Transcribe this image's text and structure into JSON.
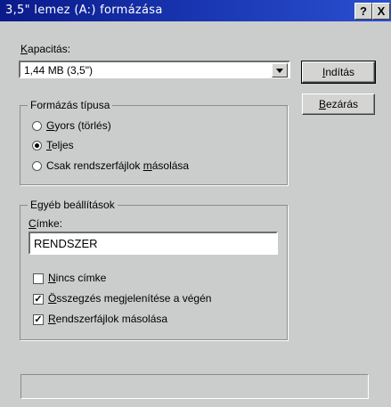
{
  "window": {
    "title": "3,5\" lemez (A:) formázása",
    "help_glyph": "?",
    "close_glyph": "X"
  },
  "capacity": {
    "label": "Kapacitás:",
    "label_key": "K",
    "label_rest": "apacitás:",
    "value": "1,44 MB (3,5\")"
  },
  "buttons": {
    "start": "Indítás",
    "start_key": "I",
    "start_rest": "ndítás",
    "close": "Bezárás",
    "close_key": "B",
    "close_rest": "ezárás"
  },
  "format_type": {
    "title": "Formázás típusa",
    "options": [
      {
        "pre": "",
        "key": "G",
        "rest": "yors (törlés)",
        "selected": false
      },
      {
        "pre": "",
        "key": "T",
        "rest": "eljes",
        "selected": true
      },
      {
        "pre": "Csak rendszerfájlok ",
        "key": "m",
        "rest": "ásolása",
        "selected": false
      }
    ]
  },
  "other": {
    "title": "Egyéb beállítások",
    "label_key": "C",
    "label_rest": "ímke:",
    "label_value": "RENDSZER",
    "checks": [
      {
        "key": "N",
        "rest": "incs címke",
        "checked": false
      },
      {
        "key": "Ö",
        "rest": "sszegzés megjelenítése a végén",
        "checked": true
      },
      {
        "key": "R",
        "rest": "endszerfájlok másolása",
        "checked": true
      }
    ]
  }
}
